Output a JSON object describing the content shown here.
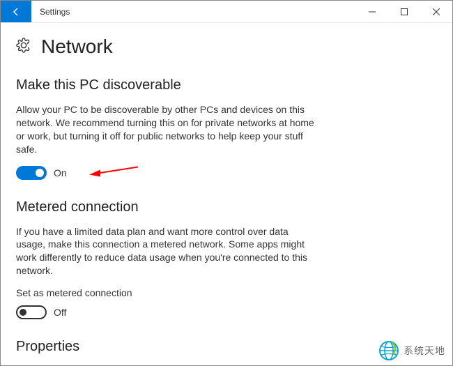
{
  "window": {
    "title": "Settings"
  },
  "page": {
    "title": "Network"
  },
  "sections": {
    "discoverable": {
      "title": "Make this PC discoverable",
      "desc": "Allow your PC to be discoverable by other PCs and devices on this network. We recommend turning this on for private networks at home or work, but turning it off for public networks to help keep your stuff safe.",
      "toggle_state": "on",
      "toggle_label": "On"
    },
    "metered": {
      "title": "Metered connection",
      "desc": "If you have a limited data plan and want more control over data usage, make this connection a metered network. Some apps might work differently to reduce data usage when you're connected to this network.",
      "field_label": "Set as metered connection",
      "toggle_state": "off",
      "toggle_label": "Off"
    },
    "properties": {
      "title": "Properties"
    }
  },
  "watermark": {
    "text": "系统天地"
  },
  "colors": {
    "accent": "#0078d7"
  }
}
